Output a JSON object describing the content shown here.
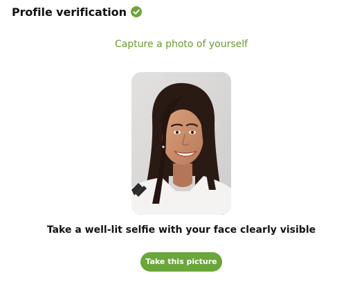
{
  "header": {
    "title": "Profile verification",
    "verified_icon": "check-circle-icon"
  },
  "main": {
    "prompt": "Capture a photo of yourself",
    "photo": "selfie-preview",
    "instruction": "Take a well-lit selfie with your face clearly visible",
    "capture_button_label": "Take this picture"
  },
  "colors": {
    "accent": "#6aa63a",
    "prompt_text": "#6a9a2f",
    "title_text": "#111111",
    "background": "#ffffff"
  }
}
